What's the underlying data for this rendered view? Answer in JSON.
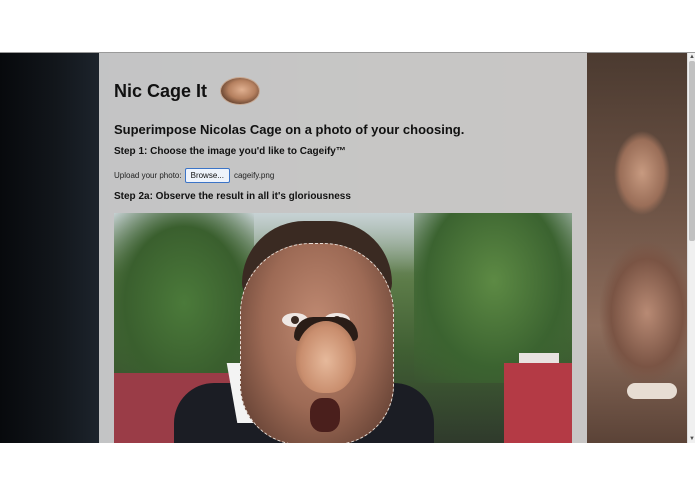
{
  "page": {
    "title": "Nic Cage It",
    "subtitle": "Superimpose Nicolas Cage on a photo of your choosing.",
    "step1": "Step 1: Choose the image you'd like to Cageify™",
    "upload": {
      "label": "Upload your photo:",
      "button_label": "Browse...",
      "filename": "cageify.png"
    },
    "step2a": "Step 2a: Observe the result in all it's gloriousness"
  },
  "colors": {
    "panel": "#d6d6d6",
    "text": "#111111",
    "browse_border": "#3b74c7"
  },
  "icons": {
    "logo": "nic-cage-face-logo",
    "scroll_up": "scroll-up-arrow-icon",
    "scroll_down": "scroll-down-arrow-icon"
  }
}
